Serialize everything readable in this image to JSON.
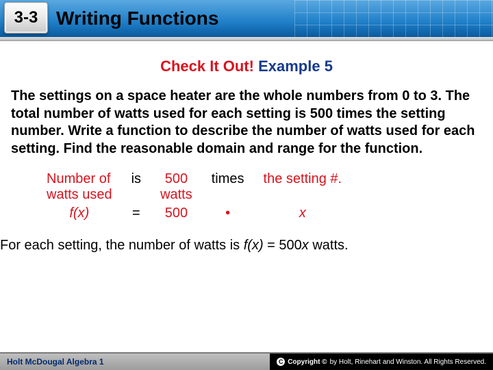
{
  "header": {
    "badge": "3-3",
    "title": "Writing Functions"
  },
  "checkit": {
    "red": "Check It Out!",
    "blue": "Example 5"
  },
  "problem": "The settings on a space heater are the whole numbers from 0 to 3. The total number of watts used for each setting is 500 times the setting number. Write a function to describe the number of watts used for each setting. Find the reasonable domain and range for the function.",
  "table": {
    "r1": {
      "c1a": "Number of",
      "c1b": "watts used",
      "c2": "is",
      "c3a": "500",
      "c3b": "watts",
      "c4": "times",
      "c5": "the setting #."
    },
    "r2": {
      "c1": "f(x)",
      "c2": "=",
      "c3": "500",
      "c4": "•",
      "c5": "x"
    }
  },
  "answer": {
    "pre": "For each setting, the number of watts is ",
    "fx": "f(x)",
    "post": " = 500",
    "xv": "x",
    "tail": " watts."
  },
  "footer": {
    "left": "Holt McDougal Algebra 1",
    "right": "by Holt, Rinehart and Winston. All Rights Reserved."
  }
}
